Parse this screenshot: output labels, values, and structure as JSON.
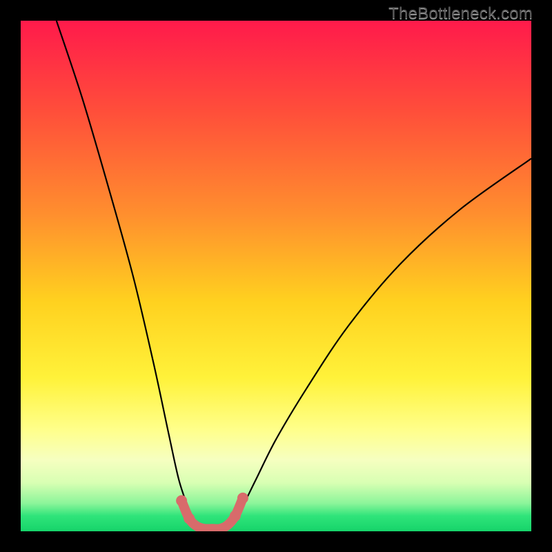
{
  "watermark": {
    "text": "TheBottleneck.com"
  },
  "chart_data": {
    "type": "line",
    "title": "",
    "xlabel": "",
    "ylabel": "",
    "xlim": [
      0,
      100
    ],
    "ylim": [
      0,
      100
    ],
    "grid": false,
    "gradient_stops": [
      {
        "pos": 0.0,
        "color": "#ff1a4b"
      },
      {
        "pos": 0.18,
        "color": "#ff4f3a"
      },
      {
        "pos": 0.38,
        "color": "#ff8f2e"
      },
      {
        "pos": 0.55,
        "color": "#ffd11f"
      },
      {
        "pos": 0.7,
        "color": "#fff23a"
      },
      {
        "pos": 0.8,
        "color": "#ffff8a"
      },
      {
        "pos": 0.86,
        "color": "#f6ffc0"
      },
      {
        "pos": 0.905,
        "color": "#d8ffb3"
      },
      {
        "pos": 0.945,
        "color": "#8cf59a"
      },
      {
        "pos": 0.97,
        "color": "#2fe47a"
      },
      {
        "pos": 1.0,
        "color": "#16d46a"
      }
    ],
    "series": [
      {
        "name": "left-branch",
        "x": [
          7,
          12,
          17,
          22,
          26,
          29,
          31,
          33,
          34,
          35
        ],
        "y": [
          100,
          85,
          68,
          50,
          33,
          19,
          10,
          4,
          1,
          0
        ]
      },
      {
        "name": "right-branch",
        "x": [
          40,
          41,
          43,
          46,
          50,
          56,
          64,
          74,
          86,
          100
        ],
        "y": [
          0,
          1,
          4,
          10,
          18,
          28,
          40,
          52,
          63,
          73
        ]
      }
    ],
    "valley_floor": {
      "name": "valley-marker",
      "color": "#d86b6b",
      "x": [
        31.5,
        33,
        34.5,
        36,
        37.5,
        39,
        40.5,
        42,
        43.5
      ],
      "y": [
        6,
        2.5,
        1,
        0.5,
        0.5,
        0.5,
        1.2,
        3,
        6.5
      ]
    }
  }
}
